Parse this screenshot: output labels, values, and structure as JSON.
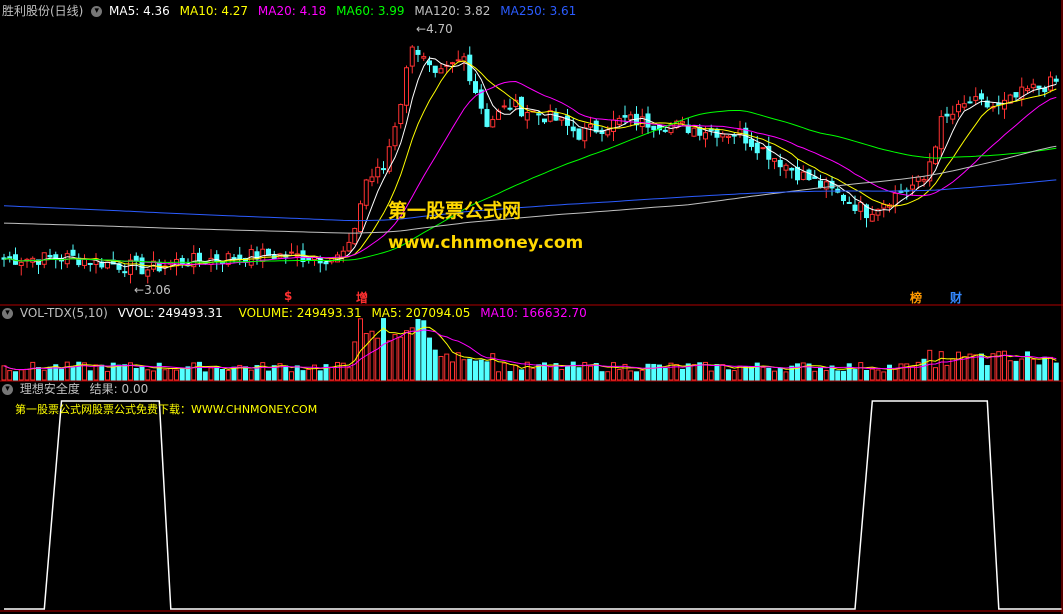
{
  "header": {
    "title": "胜利股份(日线)",
    "items": [
      {
        "label": "MA5: 4.36",
        "color": "#ffffff"
      },
      {
        "label": "MA10: 4.27",
        "color": "#ffff00"
      },
      {
        "label": "MA20: 4.18",
        "color": "#ff00ff"
      },
      {
        "label": "MA60: 3.99",
        "color": "#00ff00"
      },
      {
        "label": "MA120: 3.82",
        "color": "#c0c0c0"
      },
      {
        "label": "MA250: 3.61",
        "color": "#2b5cff"
      }
    ]
  },
  "price_annotations": {
    "high": "4.70",
    "low": "3.06"
  },
  "markers": [
    {
      "text": "$",
      "color": "#ff3030"
    },
    {
      "text": "增",
      "color": "#ff3030"
    },
    {
      "text": "榜",
      "color": "#ff9900"
    },
    {
      "text": "财",
      "color": "#3388ff"
    }
  ],
  "watermark": {
    "line1": "第一股票公式网",
    "line2": "www.chnmoney.com"
  },
  "volume_header": {
    "title": "VOL-TDX(5,10)",
    "items": [
      {
        "label": "VVOL: 249493.31",
        "color": "#ffffff"
      },
      {
        "label": "VOLUME: 249493.31",
        "color": "#ffff00"
      },
      {
        "label": "MA5: 207094.05",
        "color": "#ffff00"
      },
      {
        "label": "MA10: 166632.70",
        "color": "#ff00ff"
      }
    ]
  },
  "indicator_header": {
    "title": "理想安全度",
    "result": "结果: 0.00",
    "note": "第一股票公式网股票公式免费下载：WWW.CHNMONEY.COM"
  },
  "colors": {
    "up": "#ff3232",
    "down": "#54ffff",
    "bg": "#000000",
    "separator": "#b00000"
  },
  "chart_data": [
    {
      "type": "candlestick",
      "title": "胜利股份(日线)",
      "ylim": [
        2.9,
        4.8
      ],
      "series": [
        {
          "name": "MA5",
          "values": [
            4.36
          ]
        },
        {
          "name": "MA10",
          "values": [
            4.27
          ]
        },
        {
          "name": "MA20",
          "values": [
            4.18
          ]
        },
        {
          "name": "MA60",
          "values": [
            3.99
          ]
        },
        {
          "name": "MA120",
          "values": [
            3.82
          ]
        },
        {
          "name": "MA250",
          "values": [
            3.61
          ]
        }
      ],
      "annotations": [
        {
          "label": "4.70"
        },
        {
          "label": "3.06"
        }
      ]
    },
    {
      "type": "bar",
      "title": "VOL-TDX(5,10)",
      "series": [
        {
          "name": "VVOL",
          "values": [
            249493.31
          ]
        },
        {
          "name": "VOLUME",
          "values": [
            249493.31
          ]
        },
        {
          "name": "MA5",
          "values": [
            207094.05
          ]
        },
        {
          "name": "MA10",
          "values": [
            166632.7
          ]
        }
      ]
    },
    {
      "type": "line",
      "title": "理想安全度",
      "ylim": [
        0,
        1
      ],
      "x": [
        0,
        7,
        10,
        27,
        29,
        148,
        151,
        171,
        173,
        184
      ],
      "values": [
        0,
        0,
        1,
        1,
        0,
        0,
        1,
        1,
        0,
        0
      ]
    }
  ]
}
